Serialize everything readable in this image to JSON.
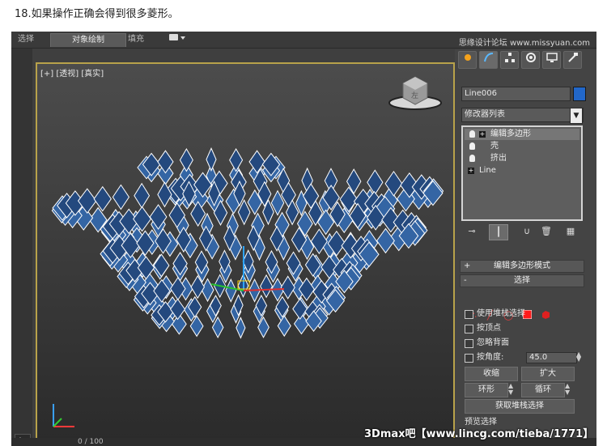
{
  "caption": "18.如果操作正确会得到很多菱形。",
  "topbar": {
    "tabs": [
      "选择",
      "对象绘制",
      "填充"
    ],
    "active_tab": "对象绘制",
    "extra_icon": "display-dropdown-icon",
    "watermark": "思缘设计论坛 www.missyuan.com"
  },
  "viewport": {
    "label": "[+] [透视] [真实]",
    "viewcube_label": "左",
    "active_border_color": "#b8a24a",
    "diamond_color": "#3465a4"
  },
  "right_panel": {
    "tab_icons": [
      "create-icon",
      "modify-icon",
      "hierarchy-icon",
      "motion-icon",
      "display-icon",
      "utilities-icon"
    ],
    "object_name": "Line006",
    "object_color": "#2267c9",
    "modifier_list": "修改器列表",
    "stack": [
      {
        "label": "编辑多边形",
        "selected": true
      },
      {
        "label": "壳",
        "selected": false
      },
      {
        "label": "挤出",
        "selected": false
      },
      {
        "label": "Line",
        "selected": false
      }
    ],
    "rollouts": {
      "edit_poly_mode": "编辑多边形模式",
      "selection": "选择"
    },
    "checkboxes": {
      "use_stack_selection": "使用堆栈选择",
      "by_vertex": "按顶点",
      "ignore_backfacing": "忽略背面",
      "by_angle": "按角度:"
    },
    "angle_value": "45.0",
    "buttons": {
      "shrink": "收缩",
      "grow": "扩大",
      "ring": "环形",
      "loop": "循环",
      "get_stack_selection": "获取堆栈选择",
      "preview_selection": "预览选择"
    }
  },
  "bottom": {
    "frame_counter": "0 / 100",
    "watermark": "3Dmax吧【www.lincg.com/tieba/1771】"
  }
}
